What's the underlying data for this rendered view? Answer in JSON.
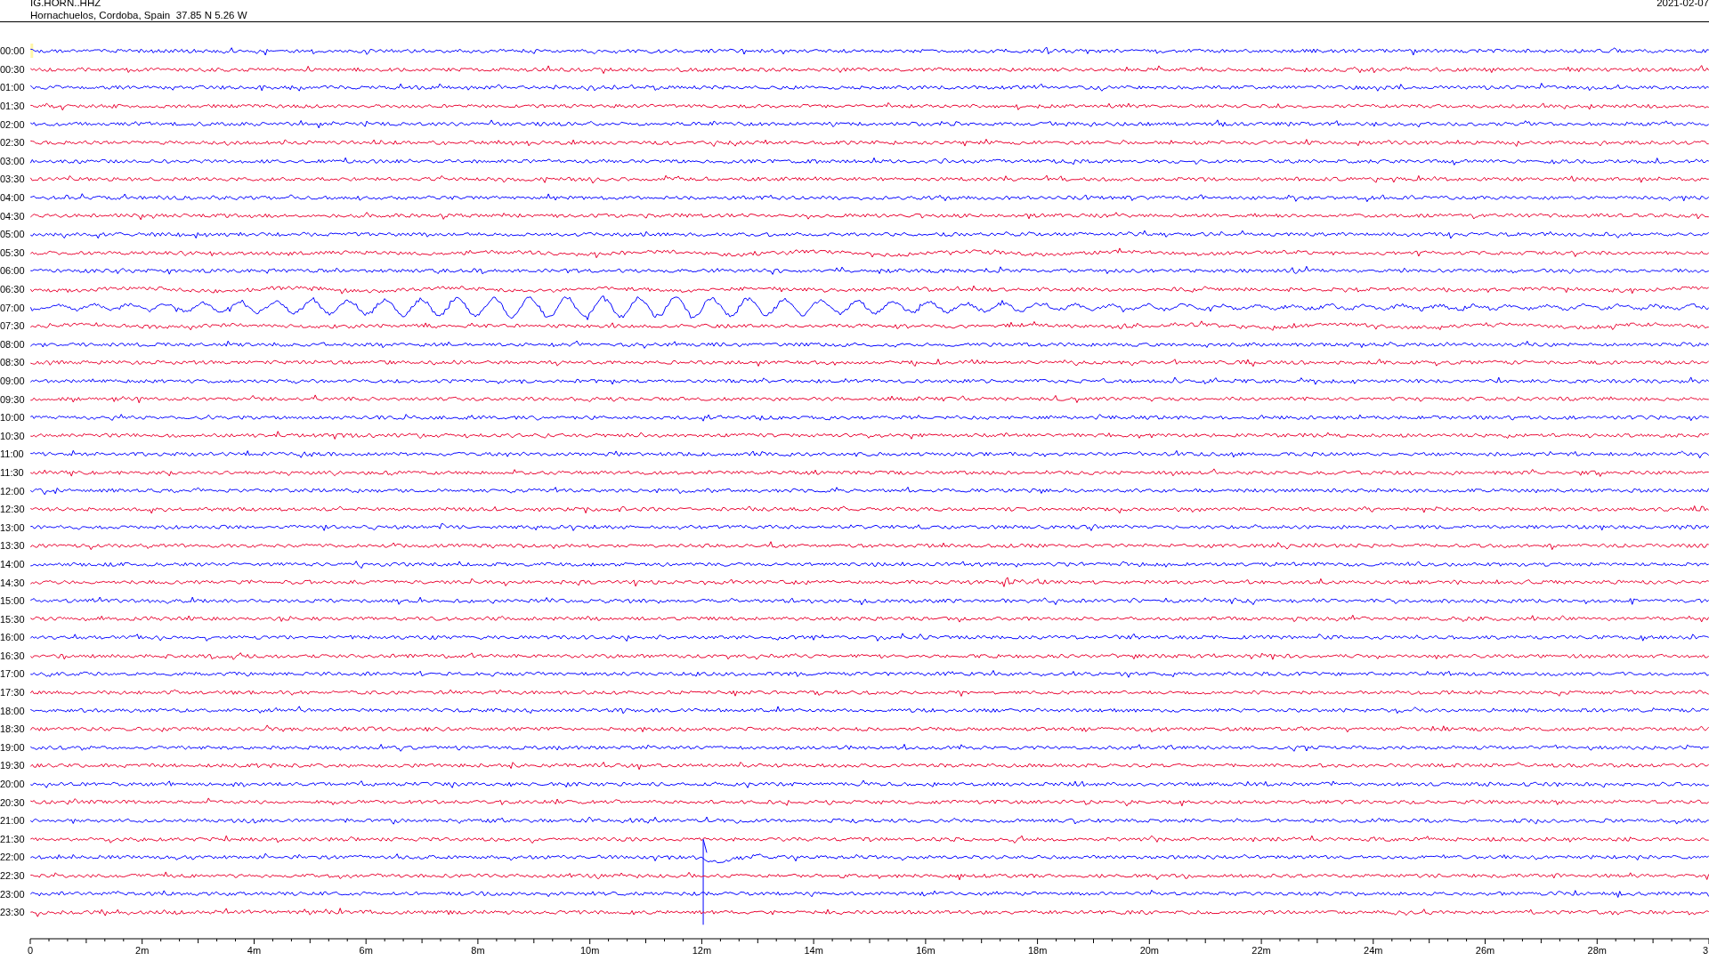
{
  "header": {
    "station": "IG.HORN..HHZ",
    "location": "Hornachuelos, Cordoba, Spain  37.85 N 5.26 W",
    "date": "2021-02-07"
  },
  "rows": [
    {
      "time": "00:00",
      "color": "#0000ff",
      "kind": "noise"
    },
    {
      "time": "00:30",
      "color": "#e8002e",
      "kind": "noise"
    },
    {
      "time": "01:00",
      "color": "#0000ff",
      "kind": "noise"
    },
    {
      "time": "01:30",
      "color": "#e8002e",
      "kind": "noise"
    },
    {
      "time": "02:00",
      "color": "#0000ff",
      "kind": "noise"
    },
    {
      "time": "02:30",
      "color": "#e8002e",
      "kind": "noise"
    },
    {
      "time": "03:00",
      "color": "#0000ff",
      "kind": "noise"
    },
    {
      "time": "03:30",
      "color": "#e8002e",
      "kind": "noise"
    },
    {
      "time": "04:00",
      "color": "#0000ff",
      "kind": "noise"
    },
    {
      "time": "04:30",
      "color": "#e8002e",
      "kind": "noise"
    },
    {
      "time": "05:00",
      "color": "#0000ff",
      "kind": "noise"
    },
    {
      "time": "05:30",
      "color": "#e8002e",
      "kind": "swell"
    },
    {
      "time": "06:00",
      "color": "#0000ff",
      "kind": "noise"
    },
    {
      "time": "06:30",
      "color": "#e8002e",
      "kind": "swell"
    },
    {
      "time": "07:00",
      "color": "#0000ff",
      "kind": "surface-waves"
    },
    {
      "time": "07:30",
      "color": "#e8002e",
      "kind": "swell"
    },
    {
      "time": "08:00",
      "color": "#0000ff",
      "kind": "noise"
    },
    {
      "time": "08:30",
      "color": "#e8002e",
      "kind": "noise"
    },
    {
      "time": "09:00",
      "color": "#0000ff",
      "kind": "noise"
    },
    {
      "time": "09:30",
      "color": "#e8002e",
      "kind": "noise"
    },
    {
      "time": "10:00",
      "color": "#0000ff",
      "kind": "noise"
    },
    {
      "time": "10:30",
      "color": "#e8002e",
      "kind": "noise"
    },
    {
      "time": "11:00",
      "color": "#0000ff",
      "kind": "noise"
    },
    {
      "time": "11:30",
      "color": "#e8002e",
      "kind": "noise"
    },
    {
      "time": "12:00",
      "color": "#0000ff",
      "kind": "noise"
    },
    {
      "time": "12:30",
      "color": "#e8002e",
      "kind": "noise"
    },
    {
      "time": "13:00",
      "color": "#0000ff",
      "kind": "noise"
    },
    {
      "time": "13:30",
      "color": "#e8002e",
      "kind": "noise"
    },
    {
      "time": "14:00",
      "color": "#0000ff",
      "kind": "noise"
    },
    {
      "time": "14:30",
      "color": "#e8002e",
      "kind": "burst"
    },
    {
      "time": "15:00",
      "color": "#0000ff",
      "kind": "noise"
    },
    {
      "time": "15:30",
      "color": "#e8002e",
      "kind": "noise"
    },
    {
      "time": "16:00",
      "color": "#0000ff",
      "kind": "noise"
    },
    {
      "time": "16:30",
      "color": "#e8002e",
      "kind": "noise"
    },
    {
      "time": "17:00",
      "color": "#0000ff",
      "kind": "noise"
    },
    {
      "time": "17:30",
      "color": "#e8002e",
      "kind": "noise"
    },
    {
      "time": "18:00",
      "color": "#0000ff",
      "kind": "noise"
    },
    {
      "time": "18:30",
      "color": "#e8002e",
      "kind": "noise"
    },
    {
      "time": "19:00",
      "color": "#0000ff",
      "kind": "noise"
    },
    {
      "time": "19:30",
      "color": "#e8002e",
      "kind": "noise"
    },
    {
      "time": "20:00",
      "color": "#0000ff",
      "kind": "noise"
    },
    {
      "time": "20:30",
      "color": "#e8002e",
      "kind": "noise"
    },
    {
      "time": "21:00",
      "color": "#0000ff",
      "kind": "noise"
    },
    {
      "time": "21:30",
      "color": "#e8002e",
      "kind": "noise"
    },
    {
      "time": "22:00",
      "color": "#0000ff",
      "kind": "spike"
    },
    {
      "time": "22:30",
      "color": "#e8002e",
      "kind": "noise"
    },
    {
      "time": "23:00",
      "color": "#0000ff",
      "kind": "noise"
    },
    {
      "time": "23:30",
      "color": "#e8002e",
      "kind": "noise"
    }
  ],
  "x_axis": {
    "labels": [
      "0",
      "2m",
      "4m",
      "6m",
      "8m",
      "10m",
      "12m",
      "14m",
      "16m",
      "18m",
      "20m",
      "22m",
      "24m",
      "26m",
      "28m",
      "3"
    ]
  }
}
